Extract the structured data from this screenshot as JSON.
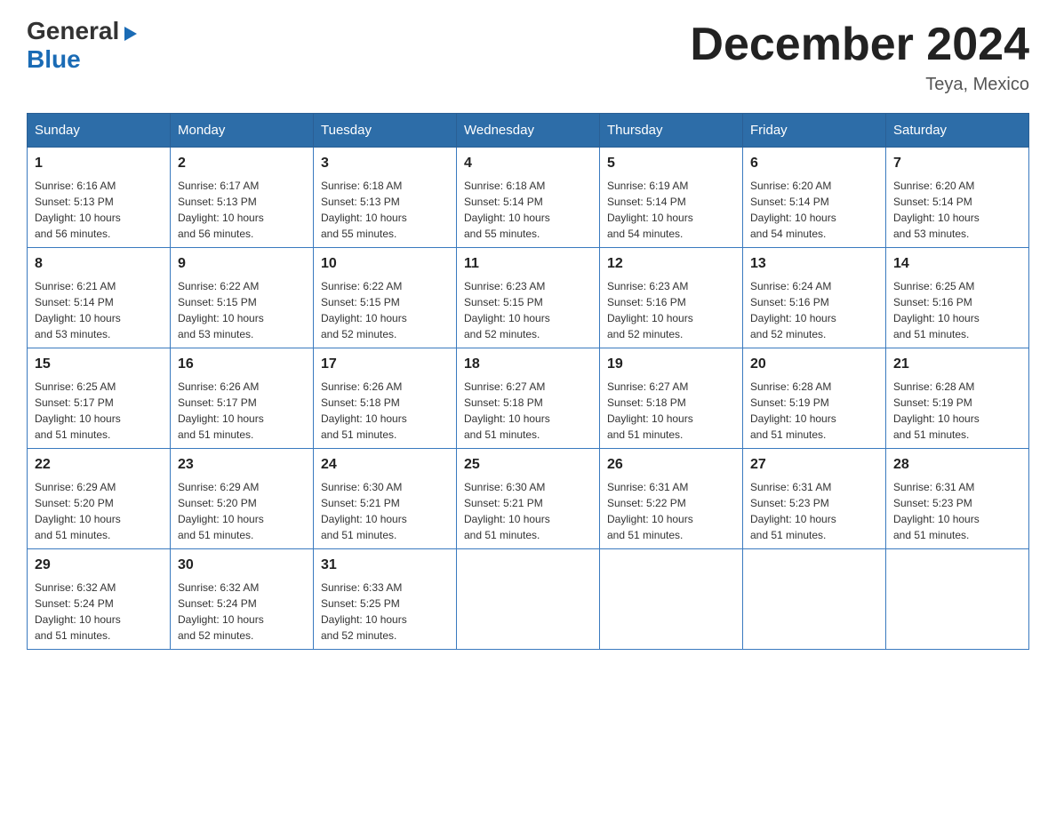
{
  "header": {
    "logo_line1": "General",
    "logo_line2": "Blue",
    "month_title": "December 2024",
    "location": "Teya, Mexico"
  },
  "days_of_week": [
    "Sunday",
    "Monday",
    "Tuesday",
    "Wednesday",
    "Thursday",
    "Friday",
    "Saturday"
  ],
  "weeks": [
    [
      {
        "day": "1",
        "sunrise": "6:16 AM",
        "sunset": "5:13 PM",
        "daylight": "10 hours and 56 minutes."
      },
      {
        "day": "2",
        "sunrise": "6:17 AM",
        "sunset": "5:13 PM",
        "daylight": "10 hours and 56 minutes."
      },
      {
        "day": "3",
        "sunrise": "6:18 AM",
        "sunset": "5:13 PM",
        "daylight": "10 hours and 55 minutes."
      },
      {
        "day": "4",
        "sunrise": "6:18 AM",
        "sunset": "5:14 PM",
        "daylight": "10 hours and 55 minutes."
      },
      {
        "day": "5",
        "sunrise": "6:19 AM",
        "sunset": "5:14 PM",
        "daylight": "10 hours and 54 minutes."
      },
      {
        "day": "6",
        "sunrise": "6:20 AM",
        "sunset": "5:14 PM",
        "daylight": "10 hours and 54 minutes."
      },
      {
        "day": "7",
        "sunrise": "6:20 AM",
        "sunset": "5:14 PM",
        "daylight": "10 hours and 53 minutes."
      }
    ],
    [
      {
        "day": "8",
        "sunrise": "6:21 AM",
        "sunset": "5:14 PM",
        "daylight": "10 hours and 53 minutes."
      },
      {
        "day": "9",
        "sunrise": "6:22 AM",
        "sunset": "5:15 PM",
        "daylight": "10 hours and 53 minutes."
      },
      {
        "day": "10",
        "sunrise": "6:22 AM",
        "sunset": "5:15 PM",
        "daylight": "10 hours and 52 minutes."
      },
      {
        "day": "11",
        "sunrise": "6:23 AM",
        "sunset": "5:15 PM",
        "daylight": "10 hours and 52 minutes."
      },
      {
        "day": "12",
        "sunrise": "6:23 AM",
        "sunset": "5:16 PM",
        "daylight": "10 hours and 52 minutes."
      },
      {
        "day": "13",
        "sunrise": "6:24 AM",
        "sunset": "5:16 PM",
        "daylight": "10 hours and 52 minutes."
      },
      {
        "day": "14",
        "sunrise": "6:25 AM",
        "sunset": "5:16 PM",
        "daylight": "10 hours and 51 minutes."
      }
    ],
    [
      {
        "day": "15",
        "sunrise": "6:25 AM",
        "sunset": "5:17 PM",
        "daylight": "10 hours and 51 minutes."
      },
      {
        "day": "16",
        "sunrise": "6:26 AM",
        "sunset": "5:17 PM",
        "daylight": "10 hours and 51 minutes."
      },
      {
        "day": "17",
        "sunrise": "6:26 AM",
        "sunset": "5:18 PM",
        "daylight": "10 hours and 51 minutes."
      },
      {
        "day": "18",
        "sunrise": "6:27 AM",
        "sunset": "5:18 PM",
        "daylight": "10 hours and 51 minutes."
      },
      {
        "day": "19",
        "sunrise": "6:27 AM",
        "sunset": "5:18 PM",
        "daylight": "10 hours and 51 minutes."
      },
      {
        "day": "20",
        "sunrise": "6:28 AM",
        "sunset": "5:19 PM",
        "daylight": "10 hours and 51 minutes."
      },
      {
        "day": "21",
        "sunrise": "6:28 AM",
        "sunset": "5:19 PM",
        "daylight": "10 hours and 51 minutes."
      }
    ],
    [
      {
        "day": "22",
        "sunrise": "6:29 AM",
        "sunset": "5:20 PM",
        "daylight": "10 hours and 51 minutes."
      },
      {
        "day": "23",
        "sunrise": "6:29 AM",
        "sunset": "5:20 PM",
        "daylight": "10 hours and 51 minutes."
      },
      {
        "day": "24",
        "sunrise": "6:30 AM",
        "sunset": "5:21 PM",
        "daylight": "10 hours and 51 minutes."
      },
      {
        "day": "25",
        "sunrise": "6:30 AM",
        "sunset": "5:21 PM",
        "daylight": "10 hours and 51 minutes."
      },
      {
        "day": "26",
        "sunrise": "6:31 AM",
        "sunset": "5:22 PM",
        "daylight": "10 hours and 51 minutes."
      },
      {
        "day": "27",
        "sunrise": "6:31 AM",
        "sunset": "5:23 PM",
        "daylight": "10 hours and 51 minutes."
      },
      {
        "day": "28",
        "sunrise": "6:31 AM",
        "sunset": "5:23 PM",
        "daylight": "10 hours and 51 minutes."
      }
    ],
    [
      {
        "day": "29",
        "sunrise": "6:32 AM",
        "sunset": "5:24 PM",
        "daylight": "10 hours and 51 minutes."
      },
      {
        "day": "30",
        "sunrise": "6:32 AM",
        "sunset": "5:24 PM",
        "daylight": "10 hours and 52 minutes."
      },
      {
        "day": "31",
        "sunrise": "6:33 AM",
        "sunset": "5:25 PM",
        "daylight": "10 hours and 52 minutes."
      },
      null,
      null,
      null,
      null
    ]
  ],
  "labels": {
    "sunrise": "Sunrise:",
    "sunset": "Sunset:",
    "daylight": "Daylight:"
  }
}
